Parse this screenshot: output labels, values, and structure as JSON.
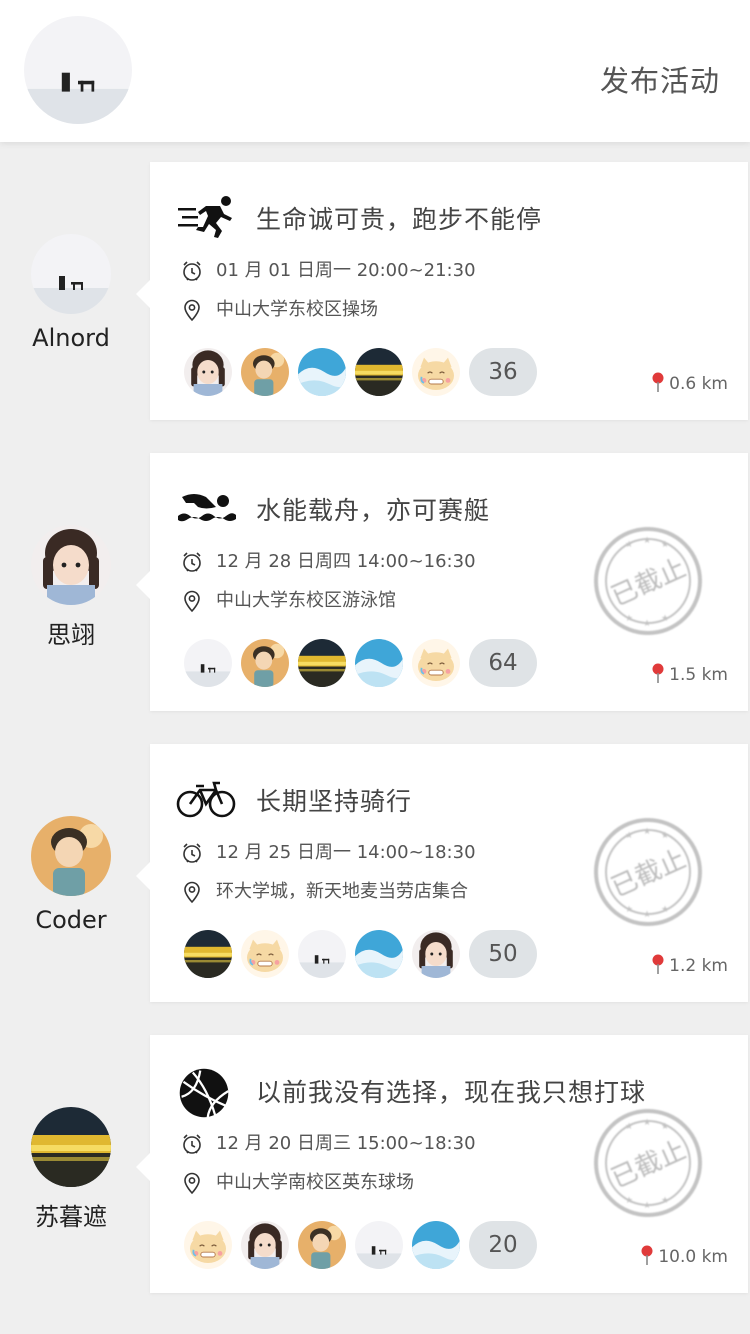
{
  "header": {
    "publish_label": "发布活动"
  },
  "stamp_text": "已截止",
  "colors": {
    "pin": "#e03a3a",
    "count_bg": "#dfe3e6",
    "background": "#efefef"
  },
  "activities": [
    {
      "user": {
        "name": "Alnord",
        "avatar": "beach-avatar"
      },
      "sport_icon": "running-icon",
      "title": "生命诚可贵，跑步不能停",
      "time": "01 月 01 日周一 20:00~21:30",
      "location": "中山大学东校区操场",
      "members": [
        "girl-avatar",
        "boy-avatar",
        "sky-avatar",
        "sunset-avatar",
        "cat-avatar"
      ],
      "count": "36",
      "distance": "0.6 km",
      "ended": false
    },
    {
      "user": {
        "name": "思翊",
        "avatar": "girl-avatar"
      },
      "sport_icon": "swimming-icon",
      "title": "水能载舟，亦可赛艇",
      "time": "12 月 28 日周四 14:00~16:30",
      "location": "中山大学东校区游泳馆",
      "members": [
        "beach-avatar",
        "boy-avatar",
        "sunset-avatar",
        "sky-avatar",
        "cat-avatar"
      ],
      "count": "64",
      "distance": "1.5 km",
      "ended": true
    },
    {
      "user": {
        "name": "Coder",
        "avatar": "boy-avatar"
      },
      "sport_icon": "bicycle-icon",
      "title": "长期坚持骑行",
      "time": "12 月 25 日周一 14:00~18:30",
      "location": "环大学城，新天地麦当劳店集合",
      "members": [
        "sunset-avatar",
        "cat-avatar",
        "beach-avatar",
        "sky-avatar",
        "girl-avatar"
      ],
      "count": "50",
      "distance": "1.2 km",
      "ended": true
    },
    {
      "user": {
        "name": "苏暮遮",
        "avatar": "sunset-avatar"
      },
      "sport_icon": "basketball-icon",
      "title": "以前我没有选择，现在我只想打球",
      "time": "12 月 20 日周三 15:00~18:30",
      "location": "中山大学南校区英东球场",
      "members": [
        "cat-avatar",
        "girl-avatar",
        "boy-avatar",
        "beach-avatar",
        "sky-avatar"
      ],
      "count": "20",
      "distance": "10.0 km",
      "ended": true
    }
  ]
}
